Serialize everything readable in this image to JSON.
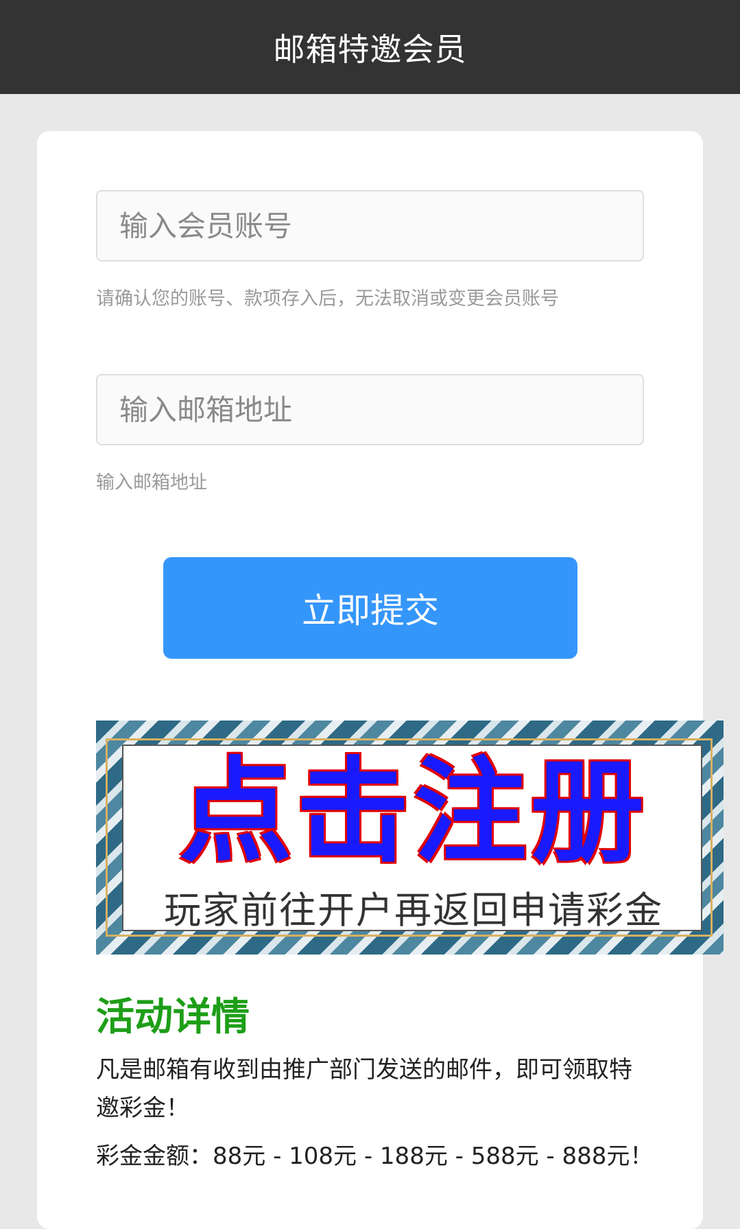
{
  "header": {
    "title": "邮箱特邀会员"
  },
  "form": {
    "account_placeholder": "输入会员账号",
    "account_value": "",
    "account_help": "请确认您的账号、款项存入后，无法取消或变更会员账号",
    "email_placeholder": "输入邮箱地址",
    "email_value": "",
    "email_help": "输入邮箱地址",
    "submit_label": "立即提交"
  },
  "banner": {
    "title": "点击注册",
    "subtitle": "玩家前往开户再返回申请彩金"
  },
  "details": {
    "title": "活动详情",
    "text": "凡是邮箱有收到由推广部门发送的邮件，即可领取特邀彩金！",
    "amount": "彩金金额：88元 - 108元 - 188元 - 588元 - 888元！"
  },
  "colors": {
    "header_bg": "#333333",
    "accent": "#3596fa",
    "detail_title": "#1e9e18"
  }
}
